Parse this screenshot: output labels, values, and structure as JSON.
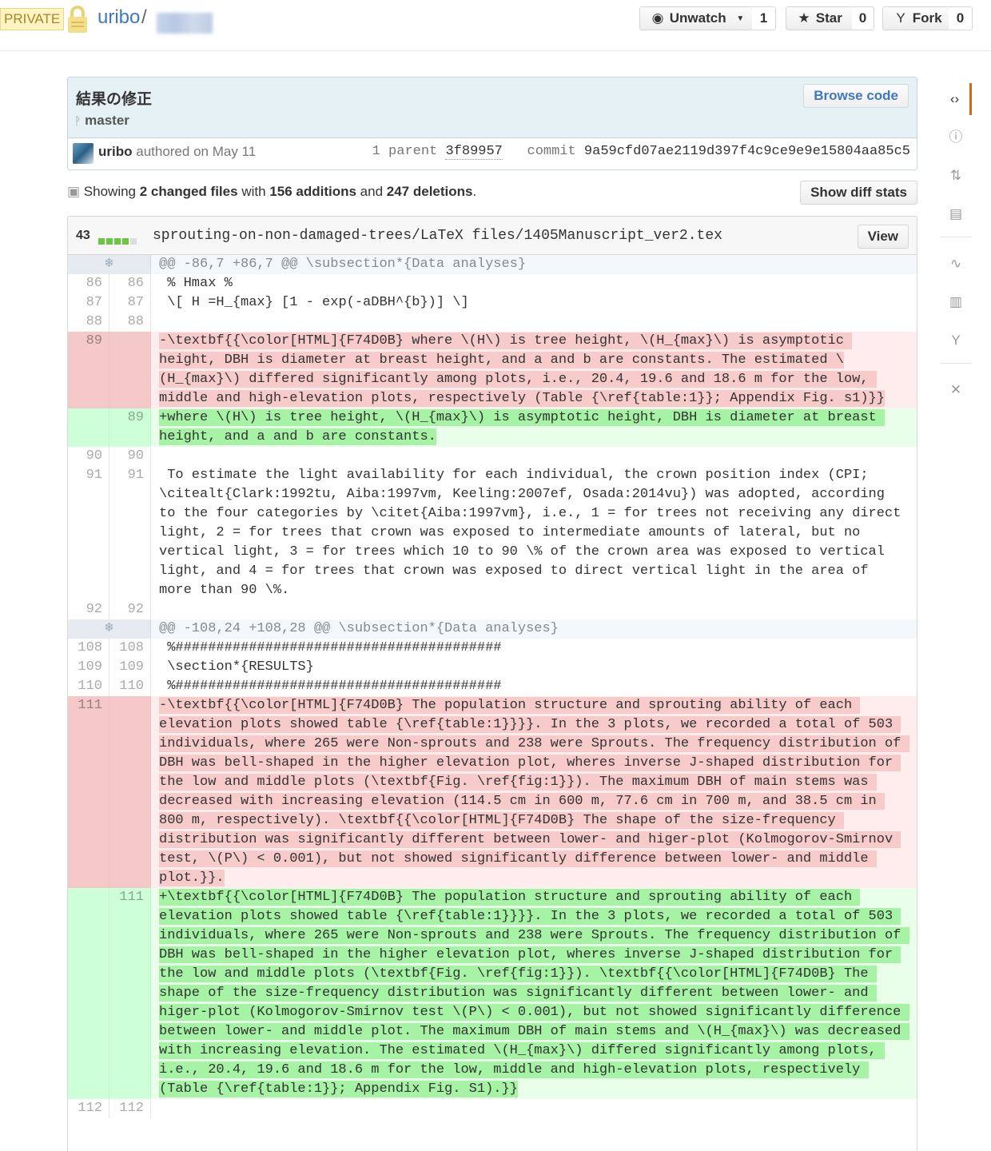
{
  "repo": {
    "private_label": "PRIVATE",
    "owner": "uribo",
    "slash": "/"
  },
  "actions": {
    "unwatch_label": "Unwatch",
    "unwatch_count": "1",
    "star_label": "Star",
    "star_count": "0",
    "fork_label": "Fork",
    "fork_count": "0"
  },
  "commit": {
    "title": "結果の修正",
    "branch": "master",
    "browse_code_label": "Browse code",
    "author": "uribo",
    "authored": "authored on May 11",
    "parent_label": "1 parent",
    "parent_sha": "3f89957",
    "commit_label": "commit",
    "commit_sha": "9a59cfd07ae2119d397f4c9ce9e9e15804aa85c5"
  },
  "toc": {
    "showing": "Showing",
    "files": "2 changed files",
    "with": "with",
    "additions": "156 additions",
    "and": "and",
    "deletions": "247 deletions",
    "period": ".",
    "diff_stats_label": "Show diff stats"
  },
  "file": {
    "count": "43",
    "path": "sprouting-on-non-damaged-trees/LaTeX files/1405Manuscript_ver2.tex",
    "view_label": "View"
  },
  "diff": [
    {
      "t": "hunk",
      "text": "@@ -86,7 +86,7 @@ \\subsection*{Data analyses}"
    },
    {
      "t": "ctx",
      "o": "86",
      "n": "86",
      "text": " % Hmax %"
    },
    {
      "t": "ctx",
      "o": "87",
      "n": "87",
      "text": " \\[ H =H_{max} [1 - exp(-aDBH^{b})] \\]"
    },
    {
      "t": "ctx",
      "o": "88",
      "n": "88",
      "text": " "
    },
    {
      "t": "del",
      "o": "89",
      "n": "",
      "text": "-\\textbf{{\\color[HTML]{F74D0B} where \\(H\\) is tree height, \\(H_{max}\\) is asymptotic height, DBH is diameter at breast height, and a and b are constants. The estimated \\(H_{max}\\) differed significantly among plots, i.e., 20.4, 19.6 and 18.6 m for the low, middle and high-elevation plots, respectively (Table {\\ref{table:1}}; Appendix Fig. s1)}}"
    },
    {
      "t": "add",
      "o": "",
      "n": "89",
      "text": "+where \\(H\\) is tree height, \\(H_{max}\\) is asymptotic height, DBH is diameter at breast height, and a and b are constants."
    },
    {
      "t": "ctx",
      "o": "90",
      "n": "90",
      "text": " "
    },
    {
      "t": "ctx",
      "o": "91",
      "n": "91",
      "text": " To estimate the light availability for each individual, the crown position index (CPI; \\citealt{Clark:1992tu, Aiba:1997vm, Keeling:2007ef, Osada:2014vu}) was adopted, according to the four categories by \\citet{Aiba:1997vm}, i.e., 1 = for trees not receiving any direct light, 2 = for trees that crown was exposed to intermediate amounts of lateral, but no vertical light, 3 = for trees which 10 to 90 \\% of the crown area was exposed to vertical light, and 4 = for trees that crown was exposed to direct vertical light in the area of more than 90 \\%."
    },
    {
      "t": "ctx",
      "o": "92",
      "n": "92",
      "text": " "
    },
    {
      "t": "hunk",
      "text": "@@ -108,24 +108,28 @@ \\subsection*{Data analyses}"
    },
    {
      "t": "ctx",
      "o": "108",
      "n": "108",
      "text": " %########################################"
    },
    {
      "t": "ctx",
      "o": "109",
      "n": "109",
      "text": " \\section*{RESULTS}"
    },
    {
      "t": "ctx",
      "o": "110",
      "n": "110",
      "text": " %########################################"
    },
    {
      "t": "del",
      "o": "111",
      "n": "",
      "text": "-\\textbf{{\\color[HTML]{F74D0B} The population structure and sprouting ability of each elevation plots showed table {\\ref{table:1}}}}. In the 3 plots, we recorded a total of 503 individuals, where 265 were Non-sprouts and 238 were Sprouts. The frequency distribution of DBH was bell-shaped in the higher elevation plot, wheres inverse J-shaped distribution for the low and middle plots (\\textbf{Fig. \\ref{fig:1}}). The maximum DBH of main stems was decreased with increasing elevation (114.5 cm in 600 m, 77.6 cm in 700 m, and 38.5 cm in 800 m, respectively). \\textbf{{\\color[HTML]{F74D0B} The shape of the size-frequency distribution was significantly different between lower- and higer-plot (Kolmogorov-Smirnov test, \\(P\\) < 0.001), but not showed significantly difference between lower- and middle plot.}}."
    },
    {
      "t": "add",
      "o": "",
      "n": "111",
      "text": "+\\textbf{{\\color[HTML]{F74D0B} The population structure and sprouting ability of each elevation plots showed table {\\ref{table:1}}}}. In the 3 plots, we recorded a total of 503 individuals, where 265 were Non-sprouts and 238 were Sprouts. The frequency distribution of DBH was bell-shaped in the higher elevation plot, wheres inverse J-shaped distribution for the low and middle plots (\\textbf{Fig. \\ref{fig:1}}). \\textbf{{\\color[HTML]{F74D0B} The shape of the size-frequency distribution was significantly different between lower- and higer-plot (Kolmogorov-Smirnov test \\(P\\) < 0.001), but not showed significantly difference between lower- and middle plot. The maximum DBH of main stems and \\(H_{max}\\) was decreased with increasing elevation. The estimated \\(H_{max}\\) differed significantly among plots, i.e., 20.4, 19.6 and 18.6 m for the low, middle and high-elevation plots, respectively (Table {\\ref{table:1}}; Appendix Fig. S1).}}"
    },
    {
      "t": "ctx",
      "o": "112",
      "n": "112",
      "text": " "
    }
  ]
}
